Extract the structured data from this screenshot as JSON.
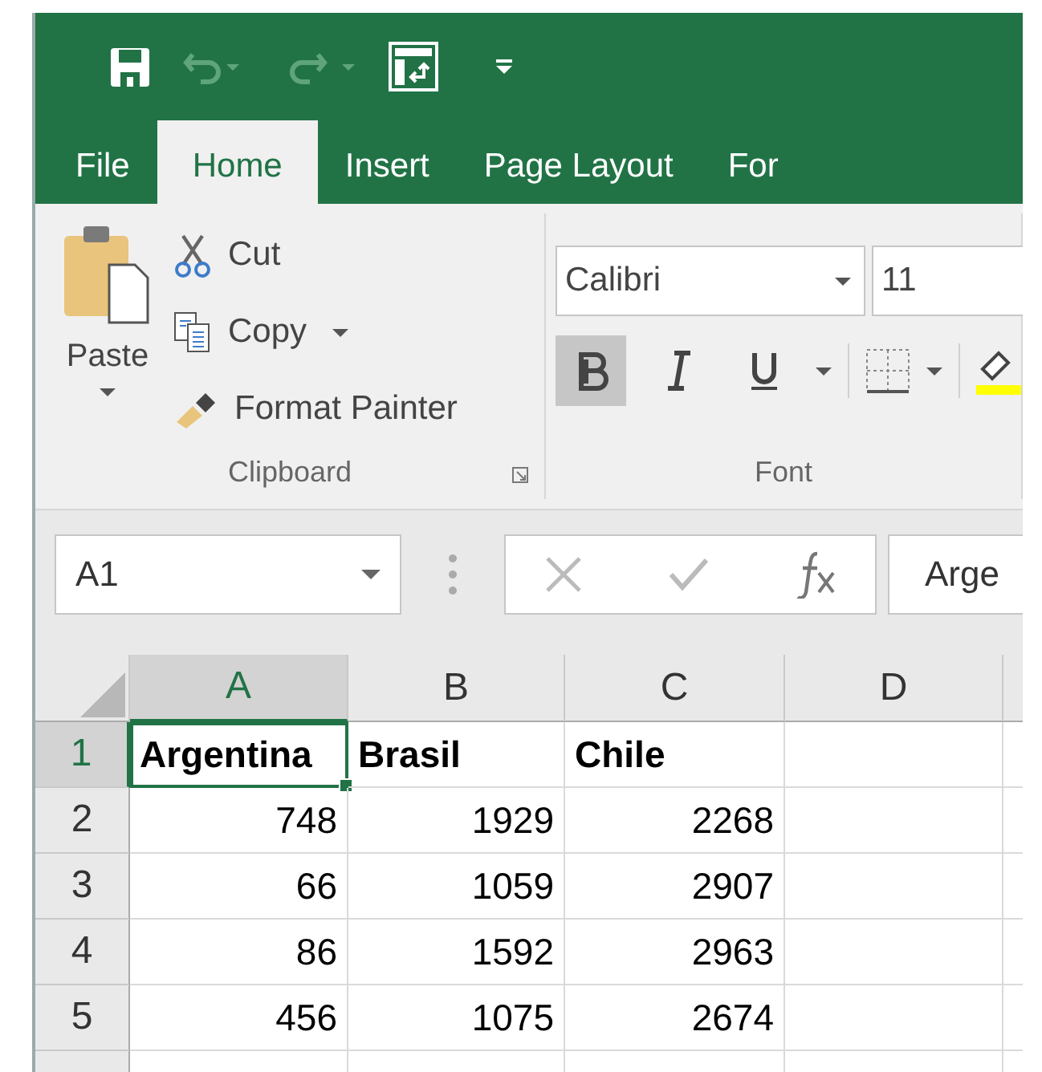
{
  "quick_access": [
    {
      "kind": "save",
      "disabled": false
    },
    {
      "kind": "undo",
      "disabled": true
    },
    {
      "kind": "redo",
      "disabled": true
    },
    {
      "kind": "view",
      "disabled": false
    },
    {
      "kind": "more",
      "disabled": false
    }
  ],
  "tabs": [
    {
      "label": "File",
      "selected": false
    },
    {
      "label": "Home",
      "selected": true
    },
    {
      "label": "Insert",
      "selected": false
    },
    {
      "label": "Page Layout",
      "selected": false
    },
    {
      "label": "For",
      "selected": false
    }
  ],
  "clipboard": {
    "paste": "Paste",
    "cut": "Cut",
    "copy": "Copy",
    "format_painter": "Format Painter",
    "label": "Clipboard"
  },
  "font": {
    "name": "Calibri",
    "size": "11",
    "bold": true,
    "italic": false,
    "underline": false,
    "label": "Font"
  },
  "formula_bar": {
    "name_box": "A1",
    "formula": "Arge"
  },
  "sheet": {
    "columns": [
      {
        "label": "A",
        "selected": true
      },
      {
        "label": "B",
        "selected": false
      },
      {
        "label": "C",
        "selected": false
      },
      {
        "label": "D",
        "selected": false
      }
    ],
    "rows": [
      {
        "number": "1",
        "selected": true,
        "cells": [
          {
            "text": "Argentina",
            "kind": "text",
            "selected": true
          },
          {
            "text": "Brasil",
            "kind": "text",
            "selected": false
          },
          {
            "text": "Chile",
            "kind": "text",
            "selected": false
          }
        ]
      },
      {
        "number": "2",
        "selected": false,
        "cells": [
          {
            "text": "748",
            "kind": "number",
            "selected": false
          },
          {
            "text": "1929",
            "kind": "number",
            "selected": false
          },
          {
            "text": "2268",
            "kind": "number",
            "selected": false
          }
        ]
      },
      {
        "number": "3",
        "selected": false,
        "cells": [
          {
            "text": "66",
            "kind": "number",
            "selected": false
          },
          {
            "text": "1059",
            "kind": "number",
            "selected": false
          },
          {
            "text": "2907",
            "kind": "number",
            "selected": false
          }
        ]
      },
      {
        "number": "4",
        "selected": false,
        "cells": [
          {
            "text": "86",
            "kind": "number",
            "selected": false
          },
          {
            "text": "1592",
            "kind": "number",
            "selected": false
          },
          {
            "text": "2963",
            "kind": "number",
            "selected": false
          }
        ]
      },
      {
        "number": "5",
        "selected": false,
        "cells": [
          {
            "text": "456",
            "kind": "number",
            "selected": false
          },
          {
            "text": "1075",
            "kind": "number",
            "selected": false
          },
          {
            "text": "2674",
            "kind": "number",
            "selected": false
          }
        ]
      }
    ]
  }
}
